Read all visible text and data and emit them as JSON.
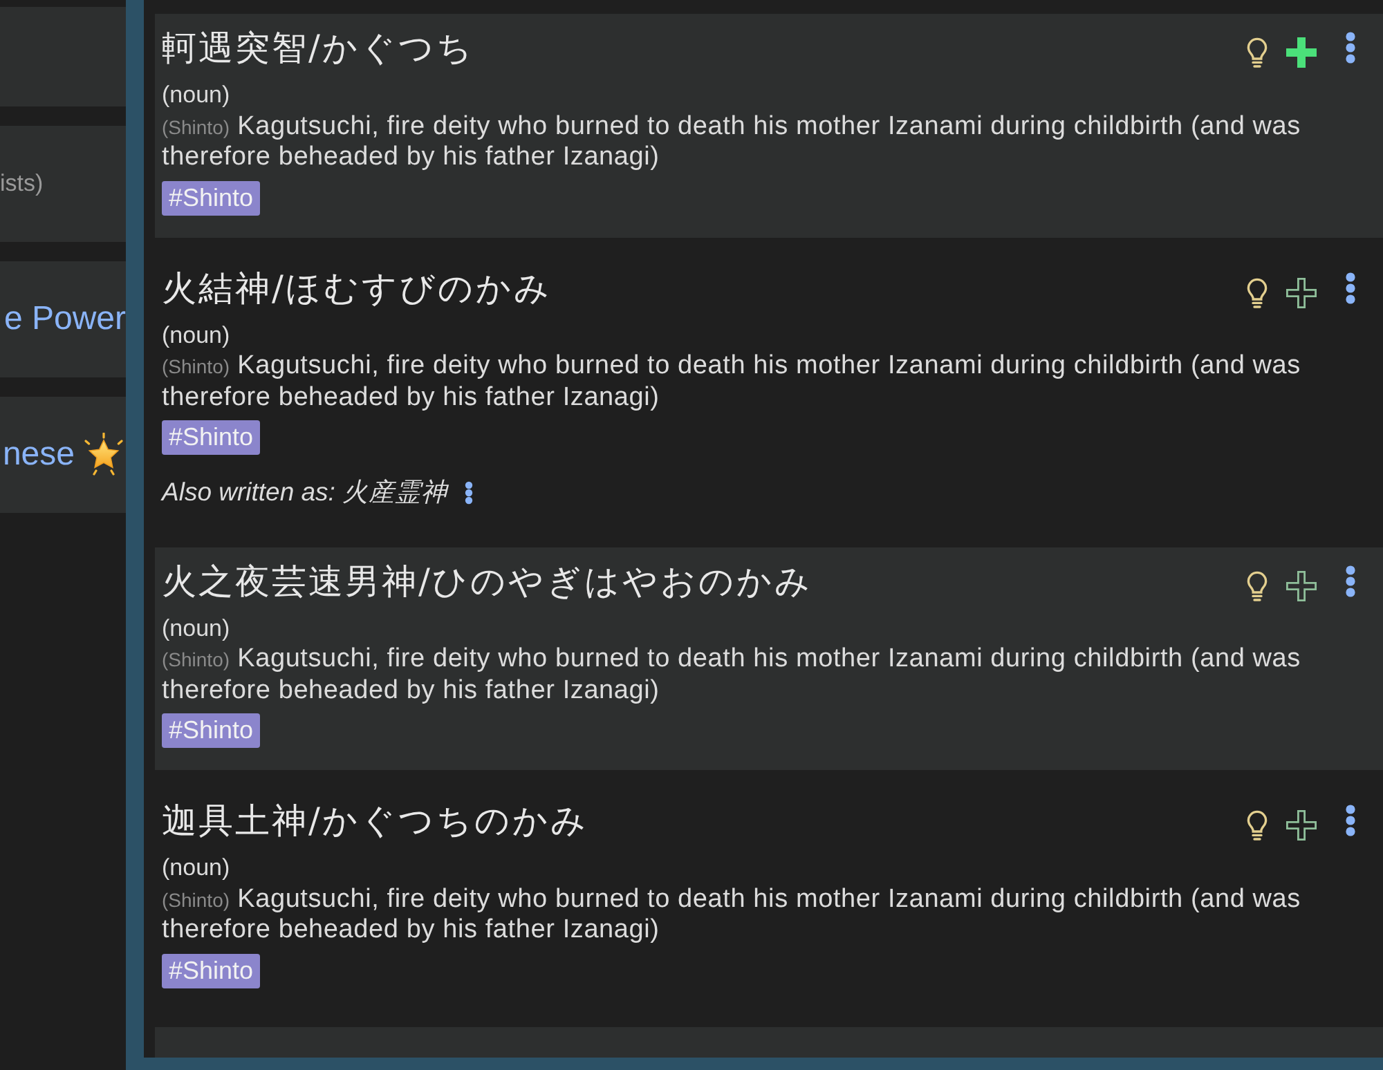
{
  "sidebar": {
    "items": [
      {
        "kind": "blank"
      },
      {
        "kind": "note",
        "text": "ists)"
      },
      {
        "kind": "link",
        "text": "e Power"
      },
      {
        "kind": "starred-link",
        "text": "nese"
      }
    ]
  },
  "entries": [
    {
      "heading": "軻遇突智/かぐつち",
      "part_of_speech": "(noun)",
      "field": "(Shinto)",
      "definition": "Kagutsuchi, fire deity who burned to death his mother Izanami during childbirth (and was therefore beheaded by his father Izanagi)",
      "tags": [
        "#Shinto"
      ],
      "added": true
    },
    {
      "heading": "火結神/ほむすびのかみ",
      "part_of_speech": "(noun)",
      "field": "(Shinto)",
      "definition": "Kagutsuchi, fire deity who burned to death his mother Izanami during childbirth (and was therefore beheaded by his father Izanagi)",
      "tags": [
        "#Shinto"
      ],
      "also_written": "Also written as: 火産霊神",
      "added": false
    },
    {
      "heading": "火之夜芸速男神/ひのやぎはやおのかみ",
      "part_of_speech": "(noun)",
      "field": "(Shinto)",
      "definition": "Kagutsuchi, fire deity who burned to death his mother Izanami during childbirth (and was therefore beheaded by his father Izanagi)",
      "tags": [
        "#Shinto"
      ],
      "added": false
    },
    {
      "heading": "迦具土神/かぐつちのかみ",
      "part_of_speech": "(noun)",
      "field": "(Shinto)",
      "definition": "Kagutsuchi, fire deity who burned to death his mother Izanami during childbirth (and was therefore beheaded by his father Izanagi)",
      "tags": [
        "#Shinto"
      ],
      "added": false
    },
    {
      "clipped": true
    }
  ]
}
